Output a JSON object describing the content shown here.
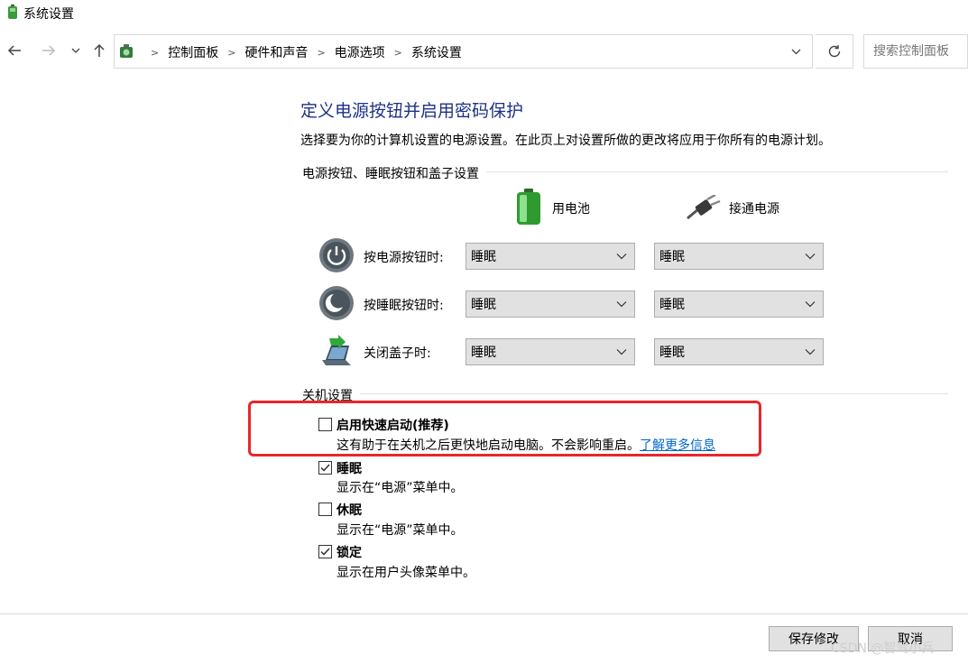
{
  "window": {
    "title": "系统设置"
  },
  "nav": {
    "back_icon": "arrow-left-icon",
    "forward_icon": "arrow-right-icon",
    "recent_icon": "chevron-down-icon",
    "up_icon": "arrow-up-icon",
    "breadcrumbs": [
      "控制面板",
      "硬件和声音",
      "电源选项",
      "系统设置"
    ],
    "search_placeholder": "搜索控制面板"
  },
  "main": {
    "title": "定义电源按钮并启用密码保护",
    "description": "选择要为你的计算机设置的电源设置。在此页上对设置所做的更改将应用于你所有的电源计划。",
    "power_group_label": "电源按钮、睡眠按钮和盖子设置",
    "columns": {
      "battery": "用电池",
      "plugged_in": "接通电源"
    },
    "rows": [
      {
        "label": "按电源按钮时:",
        "battery": "睡眠",
        "plugged_in": "睡眠"
      },
      {
        "label": "按睡眠按钮时:",
        "battery": "睡眠",
        "plugged_in": "睡眠"
      },
      {
        "label": "关闭盖子时:",
        "battery": "睡眠",
        "plugged_in": "睡眠"
      }
    ],
    "shutdown_group_label": "关机设置",
    "shutdown_options": [
      {
        "title": "启用快速启动(推荐)",
        "desc": "这有助于在关机之后更快地启动电脑。不会影响重启。",
        "link": "了解更多信息",
        "checked": false
      },
      {
        "title": "睡眠",
        "desc": "显示在“电源”菜单中。",
        "checked": true
      },
      {
        "title": "休眠",
        "desc": "显示在“电源”菜单中。",
        "checked": false
      },
      {
        "title": "锁定",
        "desc": "显示在用户头像菜单中。",
        "checked": true
      }
    ]
  },
  "footer": {
    "save": "保存修改",
    "cancel": "取消"
  },
  "watermark": "CSDN @智驾小兵",
  "colors": {
    "heading": "#1e3287",
    "link": "#0066cc",
    "highlight": "#e8272b"
  }
}
